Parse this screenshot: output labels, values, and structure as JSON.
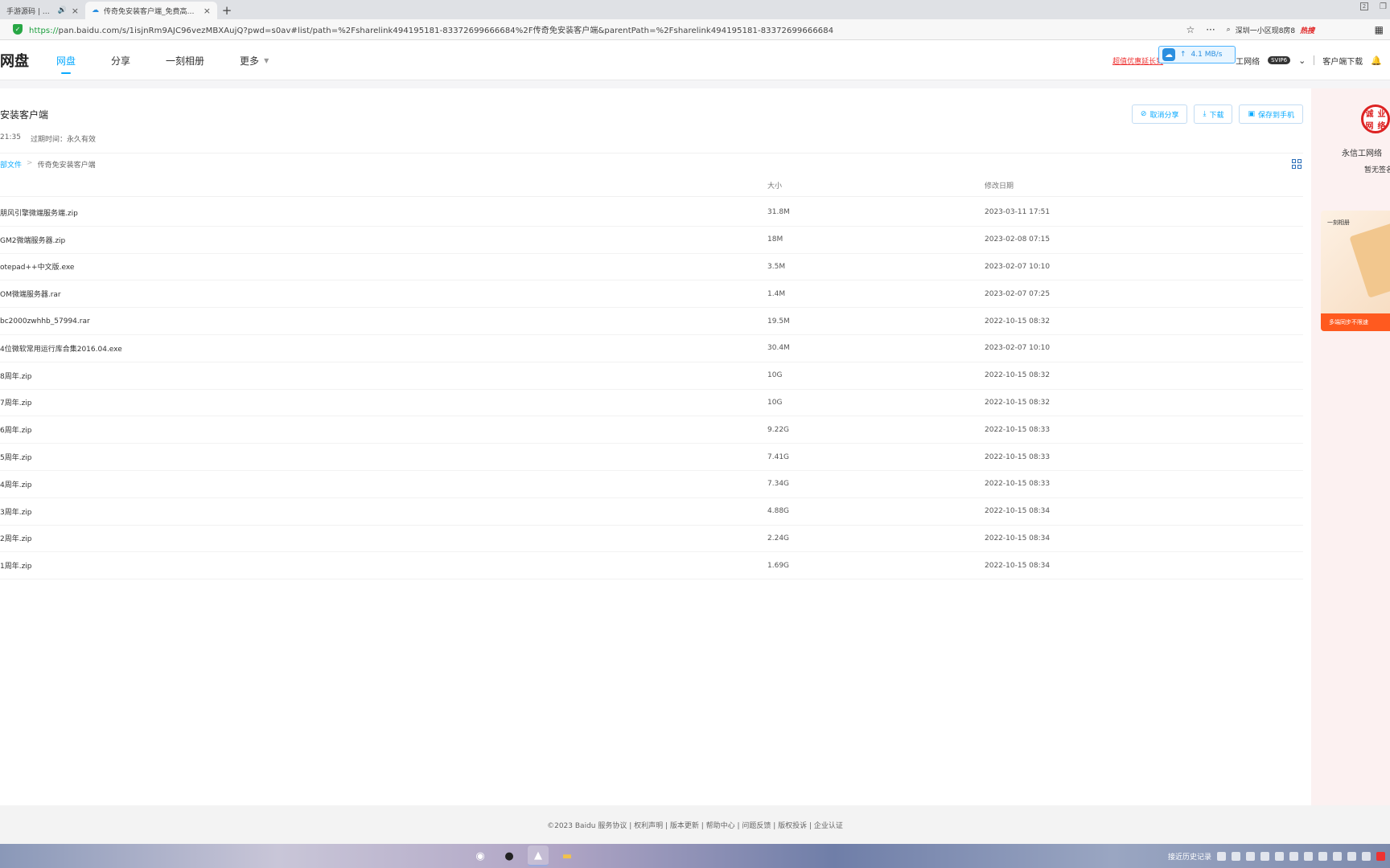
{
  "browser": {
    "tabs": [
      {
        "title": "手游源码 | 端游源",
        "active": false
      },
      {
        "title": "传奇免安装客户端_免费高速下",
        "active": true
      }
    ],
    "url_proto": "https://",
    "url_rest": "pan.baidu.com/s/1isjnRm9AJC96vezMBXAujQ?pwd=s0av#list/path=%2Fsharelink494195181-83372699666684%2F传奇免安装客户端&parentPath=%2Fsharelink494195181-83372699666684",
    "search_text": "深圳一小区现8房8",
    "hot_label": "热搜"
  },
  "header": {
    "logo": "网盘",
    "nav": [
      {
        "label": "网盘",
        "active": true
      },
      {
        "label": "分享",
        "active": false
      },
      {
        "label": "一刻相册",
        "active": false
      },
      {
        "label": "更多",
        "active": false
      }
    ],
    "promo": "超值优惠延长到",
    "speed": "4.1 MB/s",
    "user": "工网络",
    "user_badge": "SVIP6",
    "client_download": "客户端下载"
  },
  "share": {
    "title": "安装客户端",
    "time": "21:35",
    "expire": "过期时间：永久有效",
    "actions": {
      "cancel": "取消分享",
      "download": "下载",
      "save": "保存到手机"
    },
    "breadcrumb_root": "部文件",
    "breadcrumb_current": "传奇免安装客户端"
  },
  "table": {
    "col_size": "大小",
    "col_date": "修改日期",
    "rows": [
      {
        "name": "朋风引擎微端服务端.zip",
        "size": "31.8M",
        "date": "2023-03-11 17:51"
      },
      {
        "name": "GM2微端服务器.zip",
        "size": "18M",
        "date": "2023-02-08 07:15"
      },
      {
        "name": "otepad++中文版.exe",
        "size": "3.5M",
        "date": "2023-02-07 10:10"
      },
      {
        "name": "OM微端服务器.rar",
        "size": "1.4M",
        "date": "2023-02-07 07:25"
      },
      {
        "name": "bc2000zwhhb_57994.rar",
        "size": "19.5M",
        "date": "2022-10-15 08:32"
      },
      {
        "name": "4位微软常用运行库合集2016.04.exe",
        "size": "30.4M",
        "date": "2023-02-07 10:10"
      },
      {
        "name": "8周年.zip",
        "size": "10G",
        "date": "2022-10-15 08:32"
      },
      {
        "name": "7周年.zip",
        "size": "10G",
        "date": "2022-10-15 08:32"
      },
      {
        "name": "6周年.zip",
        "size": "9.22G",
        "date": "2022-10-15 08:33"
      },
      {
        "name": "5周年.zip",
        "size": "7.41G",
        "date": "2022-10-15 08:33"
      },
      {
        "name": "4周年.zip",
        "size": "7.34G",
        "date": "2022-10-15 08:33"
      },
      {
        "name": "3周年.zip",
        "size": "4.88G",
        "date": "2022-10-15 08:34"
      },
      {
        "name": "2周年.zip",
        "size": "2.24G",
        "date": "2022-10-15 08:34"
      },
      {
        "name": "1周年.zip",
        "size": "1.69G",
        "date": "2022-10-15 08:34"
      }
    ]
  },
  "side": {
    "seal_chars": [
      "诚",
      "业",
      "网",
      "络"
    ],
    "name": "永信工网络",
    "sign": "暂无签名",
    "ad_tag": "一刻相册",
    "ad_bar": "多端同步不限速"
  },
  "footer": {
    "text": "©2023 Baidu  服务协议 | 权利声明 | 版本更新 | 帮助中心 | 问题反馈 | 版权投诉 | 企业认证"
  },
  "taskbar": {
    "history": "接近历史记录"
  }
}
